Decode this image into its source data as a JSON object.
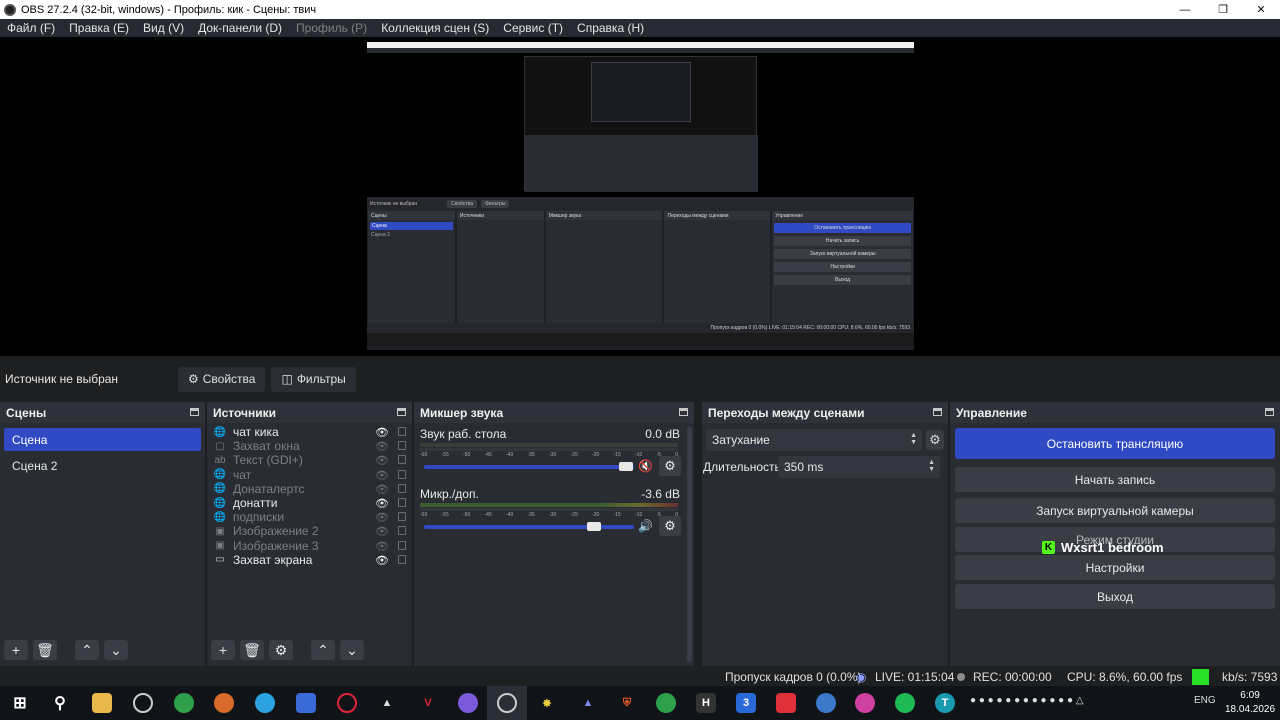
{
  "window": {
    "title": "OBS 27.2.4 (32-bit, windows) - Профиль: кик - Сцены: твич"
  },
  "menu": [
    {
      "label": "Файл (F)",
      "enabled": true
    },
    {
      "label": "Правка (E)",
      "enabled": true
    },
    {
      "label": "Вид (V)",
      "enabled": true
    },
    {
      "label": "Док-панели (D)",
      "enabled": true
    },
    {
      "label": "Профиль (P)",
      "enabled": false
    },
    {
      "label": "Коллекция сцен (S)",
      "enabled": true
    },
    {
      "label": "Сервис (T)",
      "enabled": true
    },
    {
      "label": "Справка (H)",
      "enabled": true
    }
  ],
  "source_bar": {
    "no_selection": "Источник не выбран",
    "properties": "Свойства",
    "filters": "Фильтры"
  },
  "scenes": {
    "title": "Сцены",
    "items": [
      {
        "label": "Сцена",
        "active": true
      },
      {
        "label": "Сцена 2",
        "active": false
      }
    ]
  },
  "sources": {
    "title": "Источники",
    "items": [
      {
        "label": "чат кика",
        "icon": "globe-icon",
        "visible": true
      },
      {
        "label": "Захват окна",
        "icon": "window-icon",
        "visible": false
      },
      {
        "label": "Текст (GDI+)",
        "icon": "text-icon",
        "visible": false
      },
      {
        "label": "чат",
        "icon": "globe-icon",
        "visible": false
      },
      {
        "label": "Донаталертс",
        "icon": "globe-icon",
        "visible": false
      },
      {
        "label": "донатти",
        "icon": "globe-icon",
        "visible": true
      },
      {
        "label": "подписки",
        "icon": "globe-icon",
        "visible": false
      },
      {
        "label": "Изображение 2",
        "icon": "image-icon",
        "visible": false
      },
      {
        "label": "Изображение 3",
        "icon": "image-icon",
        "visible": false
      },
      {
        "label": "Захват экрана",
        "icon": "monitor-icon",
        "visible": true
      }
    ]
  },
  "mixer": {
    "title": "Микшер звука",
    "scale": [
      "-60",
      "-55",
      "-50",
      "-45",
      "-40",
      "-35",
      "-30",
      "-25",
      "-20",
      "-15",
      "-10",
      "-5",
      "0"
    ],
    "tracks": [
      {
        "name": "Звук раб. стола",
        "db": "0.0 dB",
        "volume": 0.96,
        "muted": true
      },
      {
        "name": "Микр./доп.",
        "db": "-3.6 dB",
        "volume": 0.81,
        "muted": false
      }
    ]
  },
  "transitions": {
    "title": "Переходы между сценами",
    "selected": "Затухание",
    "duration_label": "Длительность",
    "duration_value": "350 ms"
  },
  "controls": {
    "title": "Управление",
    "stop_stream": "Остановить трансляцию",
    "start_record": "Начать запись",
    "virtual_cam": "Запуск виртуальной камеры",
    "studio_mode": "Режим студии",
    "settings": "Настройки",
    "exit": "Выход",
    "overlay_text": "Wxsrt1 bedroom"
  },
  "status": {
    "dropped": "Пропуск кадров 0 (0.0%)",
    "live": "LIVE: 01:15:04",
    "rec": "REC: 00:00:00",
    "cpu": "CPU: 8.6%, 60.00 fps",
    "kbs": "kb/s: 7593",
    "kbs_color": "#28e028"
  },
  "taskbar": {
    "lang": "ENG",
    "time": "6:09",
    "date": "18.04.2026"
  },
  "preview_thumb": {
    "nosel": "Источник не выбран",
    "props": "Свойства",
    "filters": "Фильтры",
    "scenes": "Сцены",
    "scene1": "Сцена",
    "scene2": "Сцена 2",
    "sources": "Источники",
    "mixer": "Микшер звука",
    "transitions": "Переходы между сценами",
    "controls": "Управление",
    "stop": "Остановить трансляцию",
    "rec": "Начать запись",
    "vcam": "Запуск виртуальной камеры",
    "settings": "Настройки",
    "exit": "Выход",
    "status": "Пропуск кадров 0 (0.0%)  LIVE: 01:15:04  REC: 00:00:00  CPU: 8.6%, 60.00 fps  kb/s: 7593"
  }
}
